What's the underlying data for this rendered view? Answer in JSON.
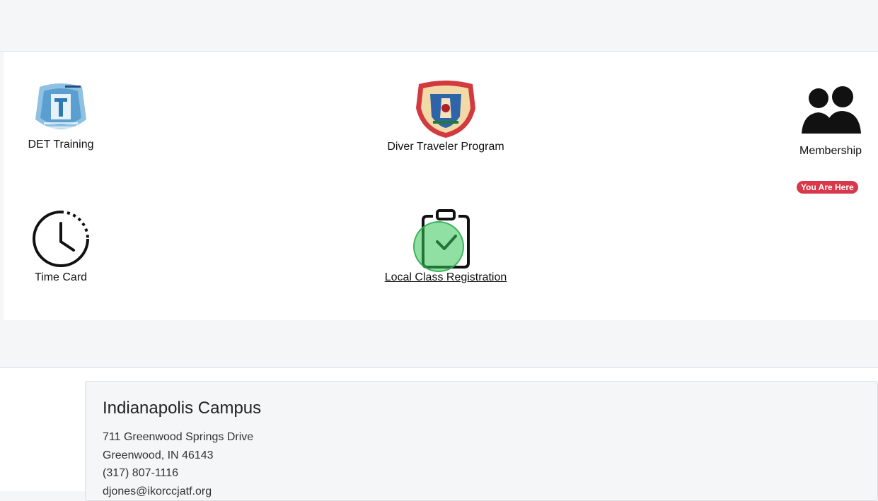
{
  "tiles": [
    {
      "label": "DET Training",
      "icon": "det-wordcloud-logo"
    },
    {
      "label": "Diver Traveler Program",
      "icon": "union-shield-logo"
    },
    {
      "label": "Membership",
      "icon": "people-icon"
    },
    {
      "label": "Time Card",
      "icon": "clock-icon"
    },
    {
      "label": "Local Class Registration",
      "icon": "clipboard-check-icon"
    }
  ],
  "badge": {
    "text": "You Are Here",
    "color": "#d9374a"
  },
  "campus": {
    "title": "Indianapolis Campus",
    "address1": "711 Greenwood Springs Drive",
    "address2": "Greenwood, IN 46143",
    "phone": "(317) 807-1116",
    "email": "djones@ikorccjatf.org"
  },
  "colors": {
    "accent_green": "#34c759",
    "badge_red": "#d9374a"
  }
}
